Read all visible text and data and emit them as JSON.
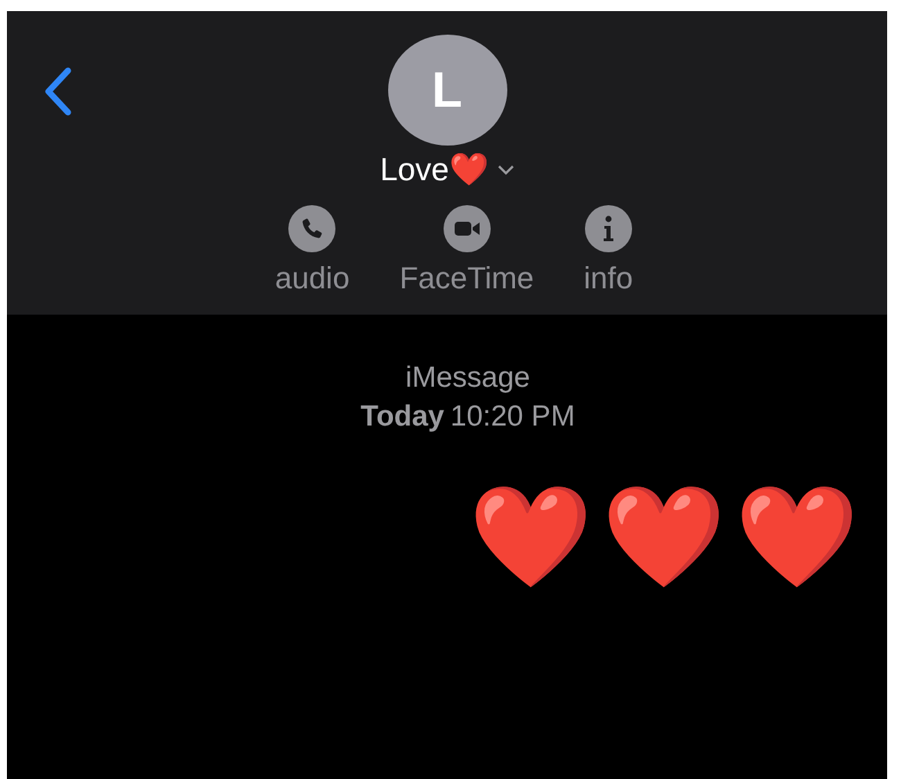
{
  "header": {
    "avatar": "L",
    "name": "Love❤️",
    "actions": [
      {
        "kind": "phone",
        "label": "audio"
      },
      {
        "kind": "video",
        "label": "FaceTime"
      },
      {
        "kind": "info",
        "label": "info"
      }
    ]
  },
  "thread": {
    "service": "iMessage",
    "date": "Today",
    "time": "10:20 PM",
    "messages": [
      {
        "text": "❤️❤️❤️",
        "outgoing": true
      }
    ]
  }
}
